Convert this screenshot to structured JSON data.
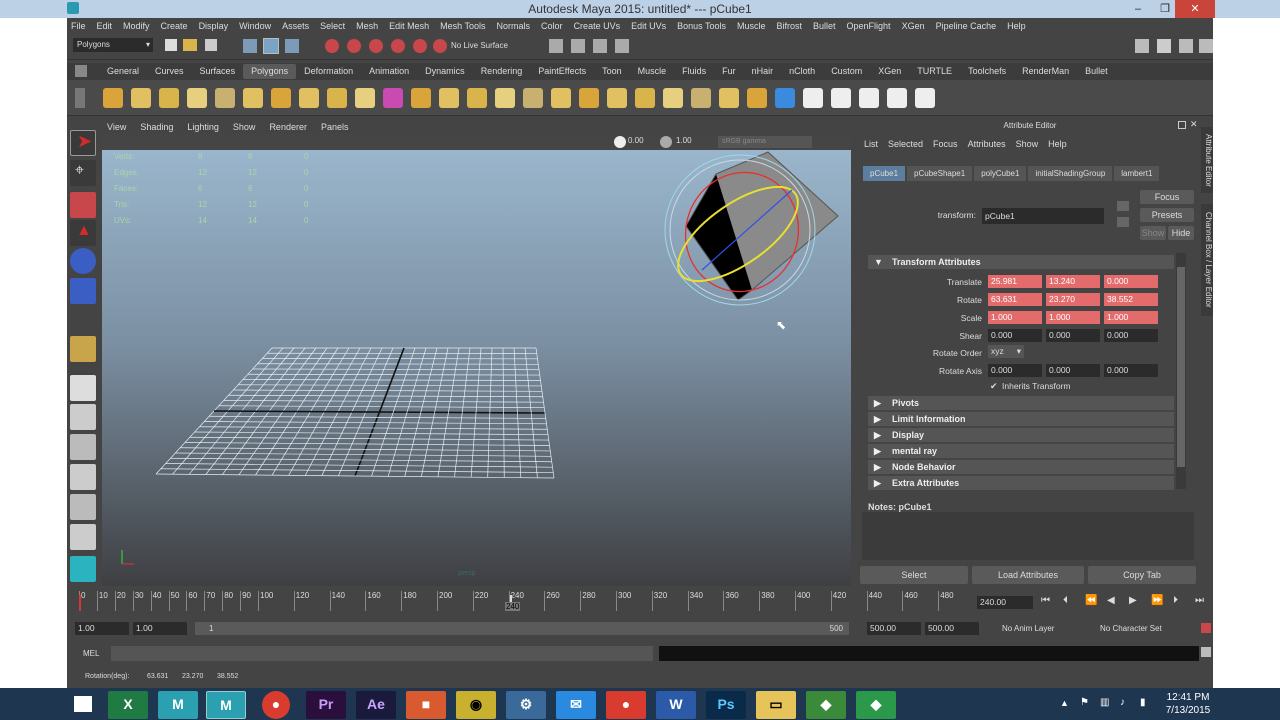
{
  "window": {
    "title": "Autodesk Maya 2015: untitled*   ---   pCube1",
    "minimize": "–",
    "maximize": "❐",
    "close": "✕"
  },
  "menubar": [
    "File",
    "Edit",
    "Modify",
    "Create",
    "Display",
    "Window",
    "Assets",
    "Select",
    "Mesh",
    "Edit Mesh",
    "Mesh Tools",
    "Normals",
    "Color",
    "Create UVs",
    "Edit UVs",
    "Bonus Tools",
    "Muscle",
    "Bifrost",
    "Bullet",
    "OpenFlight",
    "XGen",
    "Pipeline Cache",
    "Help"
  ],
  "status": {
    "menuset": "Polygons",
    "live_surface": "No Live Surface"
  },
  "shelf_tabs": [
    "General",
    "Curves",
    "Surfaces",
    "Polygons",
    "Deformation",
    "Animation",
    "Dynamics",
    "Rendering",
    "PaintEffects",
    "Toon",
    "Muscle",
    "Fluids",
    "Fur",
    "nHair",
    "nCloth",
    "Custom",
    "XGen",
    "TURTLE",
    "Toolchefs",
    "RenderMan",
    "Bullet"
  ],
  "shelf_active": "Polygons",
  "viewport": {
    "menu": [
      "View",
      "Shading",
      "Lighting",
      "Show",
      "Renderer",
      "Panels"
    ],
    "exposure": "0.00",
    "gamma": "1.00",
    "colorspace": "sRGB gamma",
    "hud": [
      {
        "label": "Verts:",
        "a": "8",
        "b": "8",
        "c": "0"
      },
      {
        "label": "Edges:",
        "a": "12",
        "b": "12",
        "c": "0"
      },
      {
        "label": "Faces:",
        "a": "6",
        "b": "6",
        "c": "0"
      },
      {
        "label": "Tris:",
        "a": "12",
        "b": "12",
        "c": "0"
      },
      {
        "label": "UVs:",
        "a": "14",
        "b": "14",
        "c": "0"
      }
    ],
    "camera_label": "persp"
  },
  "attribute_editor": {
    "title": "Attribute Editor",
    "menu": [
      "List",
      "Selected",
      "Focus",
      "Attributes",
      "Show",
      "Help"
    ],
    "tabs": [
      "pCube1",
      "pCubeShape1",
      "polyCube1",
      "initialShadingGroup",
      "lambert1"
    ],
    "active_tab": "pCube1",
    "transform_label": "transform:",
    "transform_value": "pCube1",
    "focus": "Focus",
    "presets": "Presets",
    "show": "Show",
    "hide": "Hide",
    "transform_section": "Transform Attributes",
    "translate": {
      "label": "Translate",
      "x": "25.981",
      "y": "13.240",
      "z": "0.000"
    },
    "rotate": {
      "label": "Rotate",
      "x": "63.631",
      "y": "23.270",
      "z": "38.552"
    },
    "scale": {
      "label": "Scale",
      "x": "1.000",
      "y": "1.000",
      "z": "1.000"
    },
    "shear": {
      "label": "Shear",
      "x": "0.000",
      "y": "0.000",
      "z": "0.000"
    },
    "rotate_order": {
      "label": "Rotate Order",
      "value": "xyz"
    },
    "rotate_axis": {
      "label": "Rotate Axis",
      "x": "0.000",
      "y": "0.000",
      "z": "0.000"
    },
    "inherits": "Inherits Transform",
    "sections": [
      "Pivots",
      "Limit Information",
      "Display",
      "mental ray",
      "Node Behavior",
      "Extra Attributes"
    ],
    "notes": "Notes: pCube1",
    "btn_select": "Select",
    "btn_load": "Load Attributes",
    "btn_copy": "Copy Tab",
    "vtab1": "Attribute Editor",
    "vtab2": "Channel Box / Layer Editor"
  },
  "timeline": {
    "ticks": [
      "0",
      "10",
      "20",
      "30",
      "40",
      "50",
      "60",
      "70",
      "80",
      "90",
      "100",
      "120",
      "140",
      "160",
      "180",
      "200",
      "220",
      "240",
      "260",
      "280",
      "300",
      "320",
      "340",
      "360",
      "380",
      "400",
      "420",
      "440",
      "460",
      "480"
    ],
    "current": "240",
    "current_field": "240.00"
  },
  "range": {
    "start": "1.00",
    "start2": "1.00",
    "inner_start": "1",
    "inner_end": "500",
    "end": "500.00",
    "end2": "500.00",
    "anim_layer": "No Anim Layer",
    "character": "No Character Set"
  },
  "cmd": {
    "label": "MEL"
  },
  "help": {
    "text": "Rotation(deg):",
    "x": "63.631",
    "y": "23.270",
    "z": "38.552"
  },
  "taskbar": {
    "time": "12:41 PM",
    "date": "7/13/2015"
  }
}
